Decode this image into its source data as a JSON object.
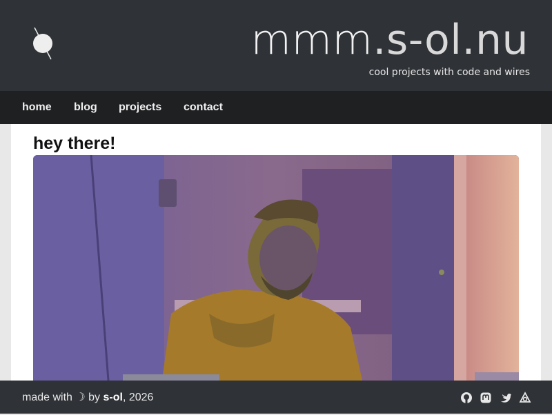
{
  "header": {
    "title_main": "mmm",
    "title_domain": ".s-ol.nu",
    "tagline": "cool projects with code and wires"
  },
  "nav": {
    "items": [
      {
        "label": "home"
      },
      {
        "label": "blog"
      },
      {
        "label": "projects"
      },
      {
        "label": "contact"
      }
    ]
  },
  "main": {
    "heading": "hey there!",
    "photo": {
      "alt": "portrait photo"
    }
  },
  "footer": {
    "made_with": "made with ☽ by ",
    "author": "s-ol",
    "year_suffix": ", 2026",
    "social_icons": [
      "github-icon",
      "mastodon-icon",
      "twitter-icon",
      "other-icon"
    ]
  }
}
